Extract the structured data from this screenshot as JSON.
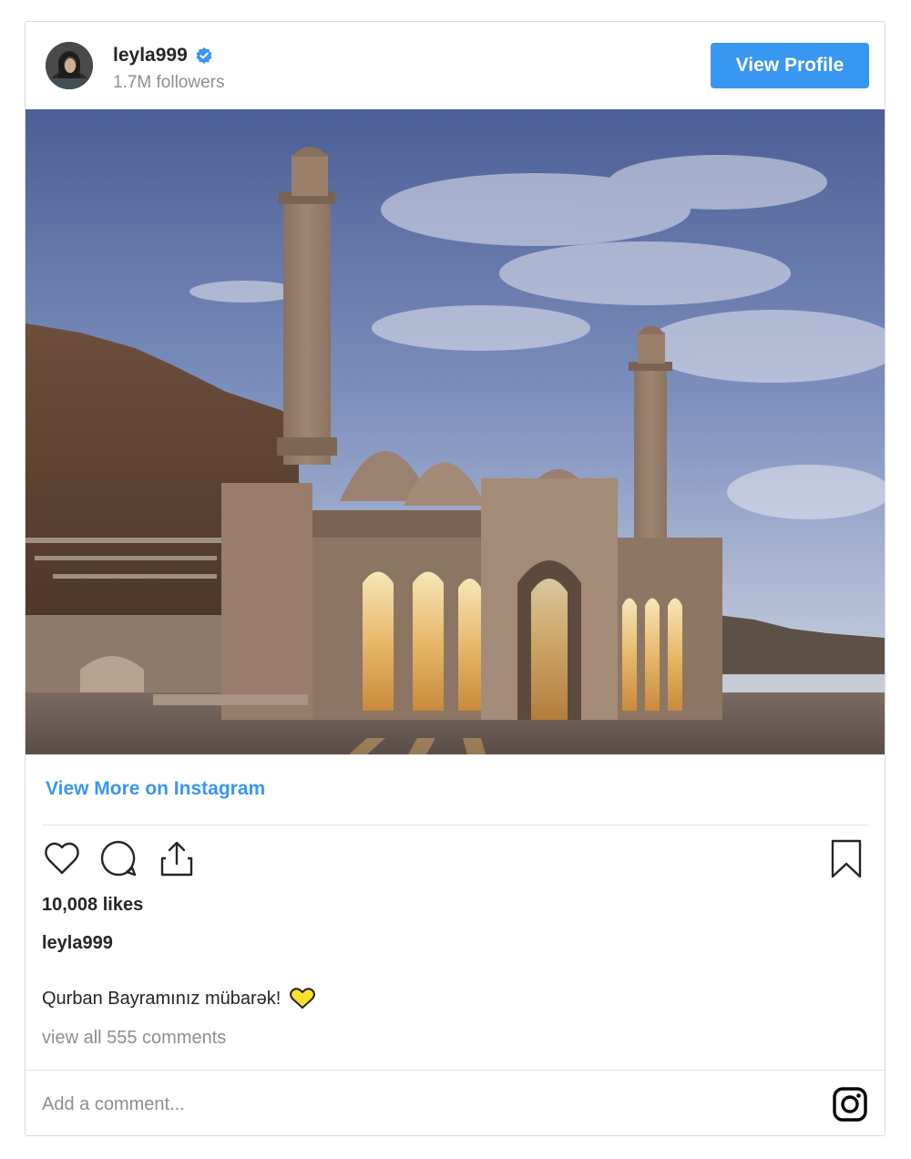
{
  "header": {
    "username": "leyla999",
    "verified": true,
    "followers": "1.7M followers",
    "view_profile_label": "View Profile"
  },
  "post": {
    "image_alt": "Mosque with two minarets at sunset",
    "view_more_label": "View More on Instagram",
    "likes": "10,008 likes",
    "caption_user": "leyla999",
    "caption_text": "Qurban Bayramınız mübarək!",
    "comments_link": "view all 555 comments"
  },
  "comment_box": {
    "placeholder": "Add a comment..."
  },
  "icons": {
    "like": "heart-outline-icon",
    "comment": "speech-bubble-icon",
    "share": "share-upload-icon",
    "save": "bookmark-icon",
    "brand": "instagram-logo-icon",
    "caption_emoji": "yellow-heart-icon"
  },
  "colors": {
    "accent": "#3897f0",
    "text": "#262626",
    "muted": "#8e8e8e",
    "border": "#dbdbdb",
    "emoji_yellow": "#f5e22c"
  }
}
